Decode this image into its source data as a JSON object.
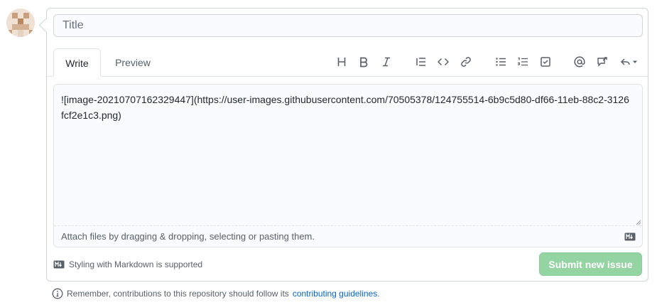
{
  "title_input": {
    "placeholder": "Title",
    "value": ""
  },
  "tabs": [
    {
      "label": "Write",
      "active": true
    },
    {
      "label": "Preview",
      "active": false
    }
  ],
  "toolbar": {
    "icons": [
      "heading-icon",
      "bold-icon",
      "italic-icon",
      "quote-icon",
      "code-icon",
      "link-icon",
      "bulleted-list-icon",
      "numbered-list-icon",
      "task-list-icon",
      "mention-icon",
      "reference-icon",
      "reply-icon"
    ]
  },
  "editor": {
    "content": "![image-20210707162329447](https://user-images.githubusercontent.com/70505378/124755514-6b9c5d80-df66-11eb-88c2-3126fcf2e1c3.png)",
    "attach_hint": "Attach files by dragging & dropping, selecting or pasting them."
  },
  "footer": {
    "markdown_note": "Styling with Markdown is supported",
    "submit_label": "Submit new issue"
  },
  "bottom_note": {
    "prefix": "Remember, contributions to this repository should follow its",
    "link_text": "contributing guidelines",
    "suffix": "."
  },
  "colors": {
    "submit_disabled": "#94d3a2",
    "link": "#0366d6",
    "border": "#d1d5da"
  }
}
